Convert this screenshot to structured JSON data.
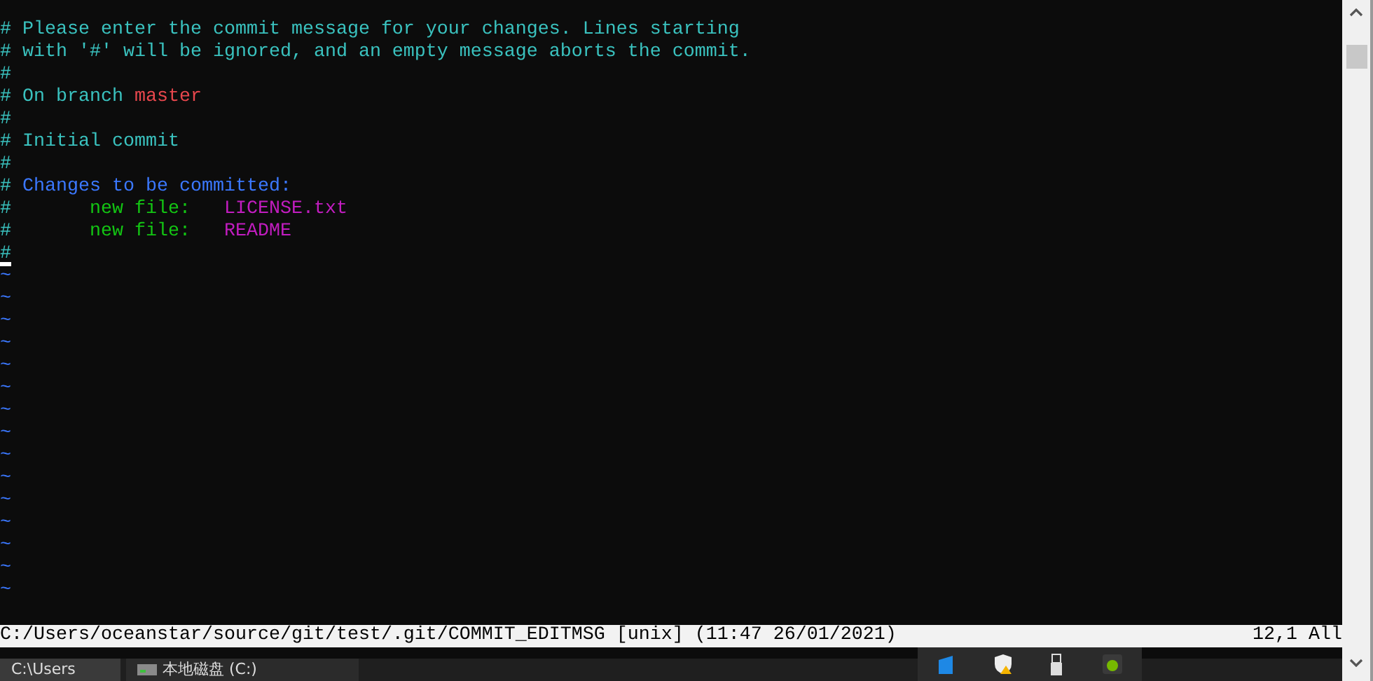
{
  "editor": {
    "lines": [
      {
        "cursor": false,
        "segments": [
          {
            "kind": "comment",
            "text": "# Please enter the commit message for your changes. Lines starting"
          }
        ]
      },
      {
        "cursor": false,
        "segments": [
          {
            "kind": "comment",
            "text": "# with '#' will be ignored, and an empty message aborts the commit."
          }
        ]
      },
      {
        "cursor": false,
        "segments": [
          {
            "kind": "comment",
            "text": "#"
          }
        ]
      },
      {
        "cursor": false,
        "segments": [
          {
            "kind": "comment",
            "text": "# On branch "
          },
          {
            "kind": "branch",
            "text": "master"
          }
        ]
      },
      {
        "cursor": false,
        "segments": [
          {
            "kind": "comment",
            "text": "#"
          }
        ]
      },
      {
        "cursor": false,
        "segments": [
          {
            "kind": "comment",
            "text": "# Initial commit"
          }
        ]
      },
      {
        "cursor": false,
        "segments": [
          {
            "kind": "comment",
            "text": "#"
          }
        ]
      },
      {
        "cursor": false,
        "segments": [
          {
            "kind": "comment",
            "text": "# "
          },
          {
            "kind": "header",
            "text": "Changes to be committed:"
          }
        ]
      },
      {
        "cursor": false,
        "segments": [
          {
            "kind": "comment",
            "text": "#       "
          },
          {
            "kind": "status",
            "text": "new file:   "
          },
          {
            "kind": "file",
            "text": "LICENSE.txt"
          }
        ]
      },
      {
        "cursor": false,
        "segments": [
          {
            "kind": "comment",
            "text": "#       "
          },
          {
            "kind": "status",
            "text": "new file:   "
          },
          {
            "kind": "file",
            "text": "README"
          }
        ]
      },
      {
        "cursor": true,
        "segments": [
          {
            "kind": "comment",
            "text": "#"
          }
        ]
      }
    ],
    "empty_lines": [
      "~",
      "~",
      "~",
      "~",
      "~",
      "~",
      "~",
      "~",
      "~",
      "~",
      "~",
      "~",
      "~",
      "~",
      "~"
    ]
  },
  "status_bar": {
    "file": "C:/Users/oceanstar/source/git/test/.git/COMMIT_EDITMSG [unix] (11:47 26/01/2021)",
    "position": "12,1 All"
  },
  "taskbar": {
    "items": [
      {
        "kind": "folder",
        "label": "C:\\Users"
      },
      {
        "kind": "drive",
        "label": "本地磁盘 (C:)"
      }
    ]
  }
}
